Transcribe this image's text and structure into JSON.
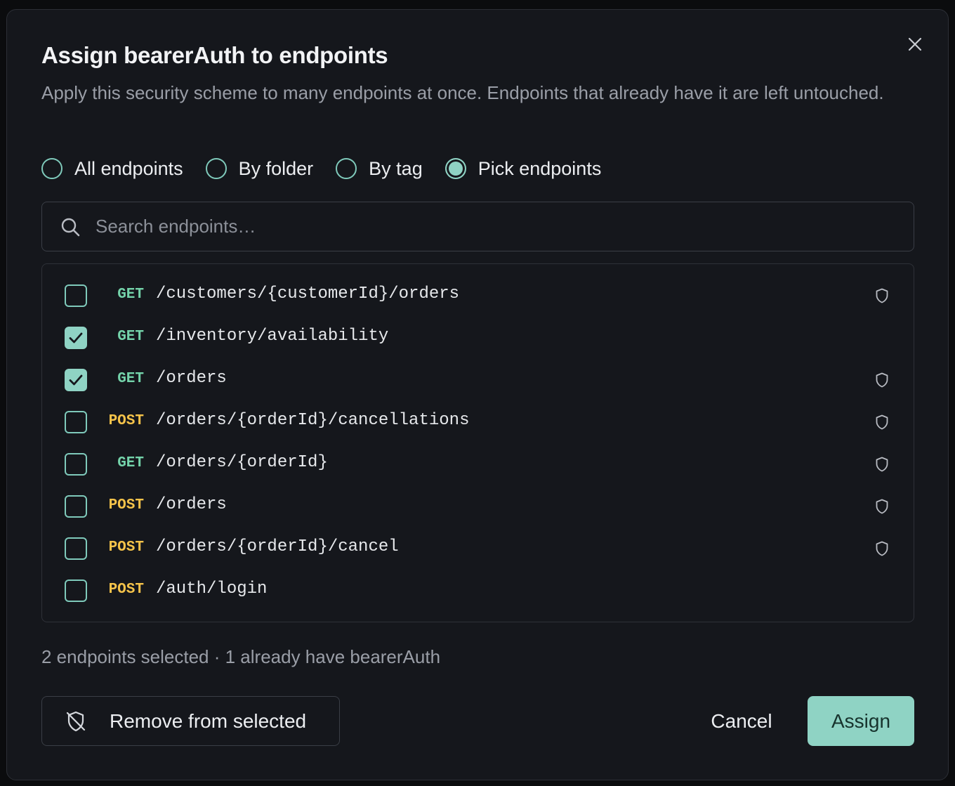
{
  "dialog": {
    "title": "Assign bearerAuth to endpoints",
    "description": "Apply this security scheme to many endpoints at once. Endpoints that already have it are left untouched.",
    "close_icon": "close-icon"
  },
  "scope_options": [
    {
      "label": "All endpoints",
      "selected": false
    },
    {
      "label": "By folder",
      "selected": false
    },
    {
      "label": "By tag",
      "selected": false
    },
    {
      "label": "Pick endpoints",
      "selected": true
    }
  ],
  "search": {
    "placeholder": "Search endpoints…",
    "value": "",
    "icon": "search-icon"
  },
  "endpoints": [
    {
      "method": "GET",
      "path": "/customers/{customerId}/orders",
      "checked": false,
      "has_scheme": true
    },
    {
      "method": "GET",
      "path": "/inventory/availability",
      "checked": true,
      "has_scheme": false
    },
    {
      "method": "GET",
      "path": "/orders",
      "checked": true,
      "has_scheme": true
    },
    {
      "method": "POST",
      "path": "/orders/{orderId}/cancellations",
      "checked": false,
      "has_scheme": true
    },
    {
      "method": "GET",
      "path": "/orders/{orderId}",
      "checked": false,
      "has_scheme": true
    },
    {
      "method": "POST",
      "path": "/orders",
      "checked": false,
      "has_scheme": true
    },
    {
      "method": "POST",
      "path": "/orders/{orderId}/cancel",
      "checked": false,
      "has_scheme": true
    },
    {
      "method": "POST",
      "path": "/auth/login",
      "checked": false,
      "has_scheme": false
    }
  ],
  "summary": "2 endpoints selected · 1 already have bearerAuth",
  "footer": {
    "remove_label": "Remove from selected",
    "remove_icon": "shield-off-icon",
    "cancel_label": "Cancel",
    "assign_label": "Assign"
  },
  "colors": {
    "accent": "#8fd3c4",
    "get": "#74d3aa",
    "post": "#f5c34a",
    "dialog_bg": "#15171c"
  }
}
